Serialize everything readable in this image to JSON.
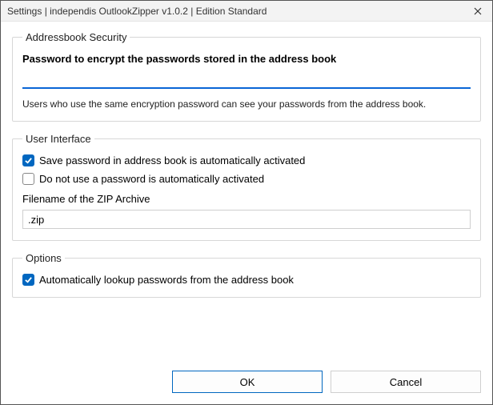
{
  "titlebar": {
    "text": "Settings   |   independis OutlookZipper v1.0.2   |   Edition Standard"
  },
  "addressbook": {
    "legend": "Addressbook Security",
    "password_label": "Password to encrypt the passwords stored in the address book",
    "password_value": "",
    "hint": "Users who use the same encryption password can see your passwords from the address book."
  },
  "ui": {
    "legend": "User Interface",
    "save_pw_label": "Save password in address book is automatically activated",
    "no_pw_label": "Do not use a password is automatically activated",
    "filename_label": "Filename of the ZIP Archive",
    "filename_value": ".zip"
  },
  "options": {
    "legend": "Options",
    "auto_lookup_label": "Automatically lookup passwords from the address book"
  },
  "buttons": {
    "ok": "OK",
    "cancel": "Cancel"
  }
}
